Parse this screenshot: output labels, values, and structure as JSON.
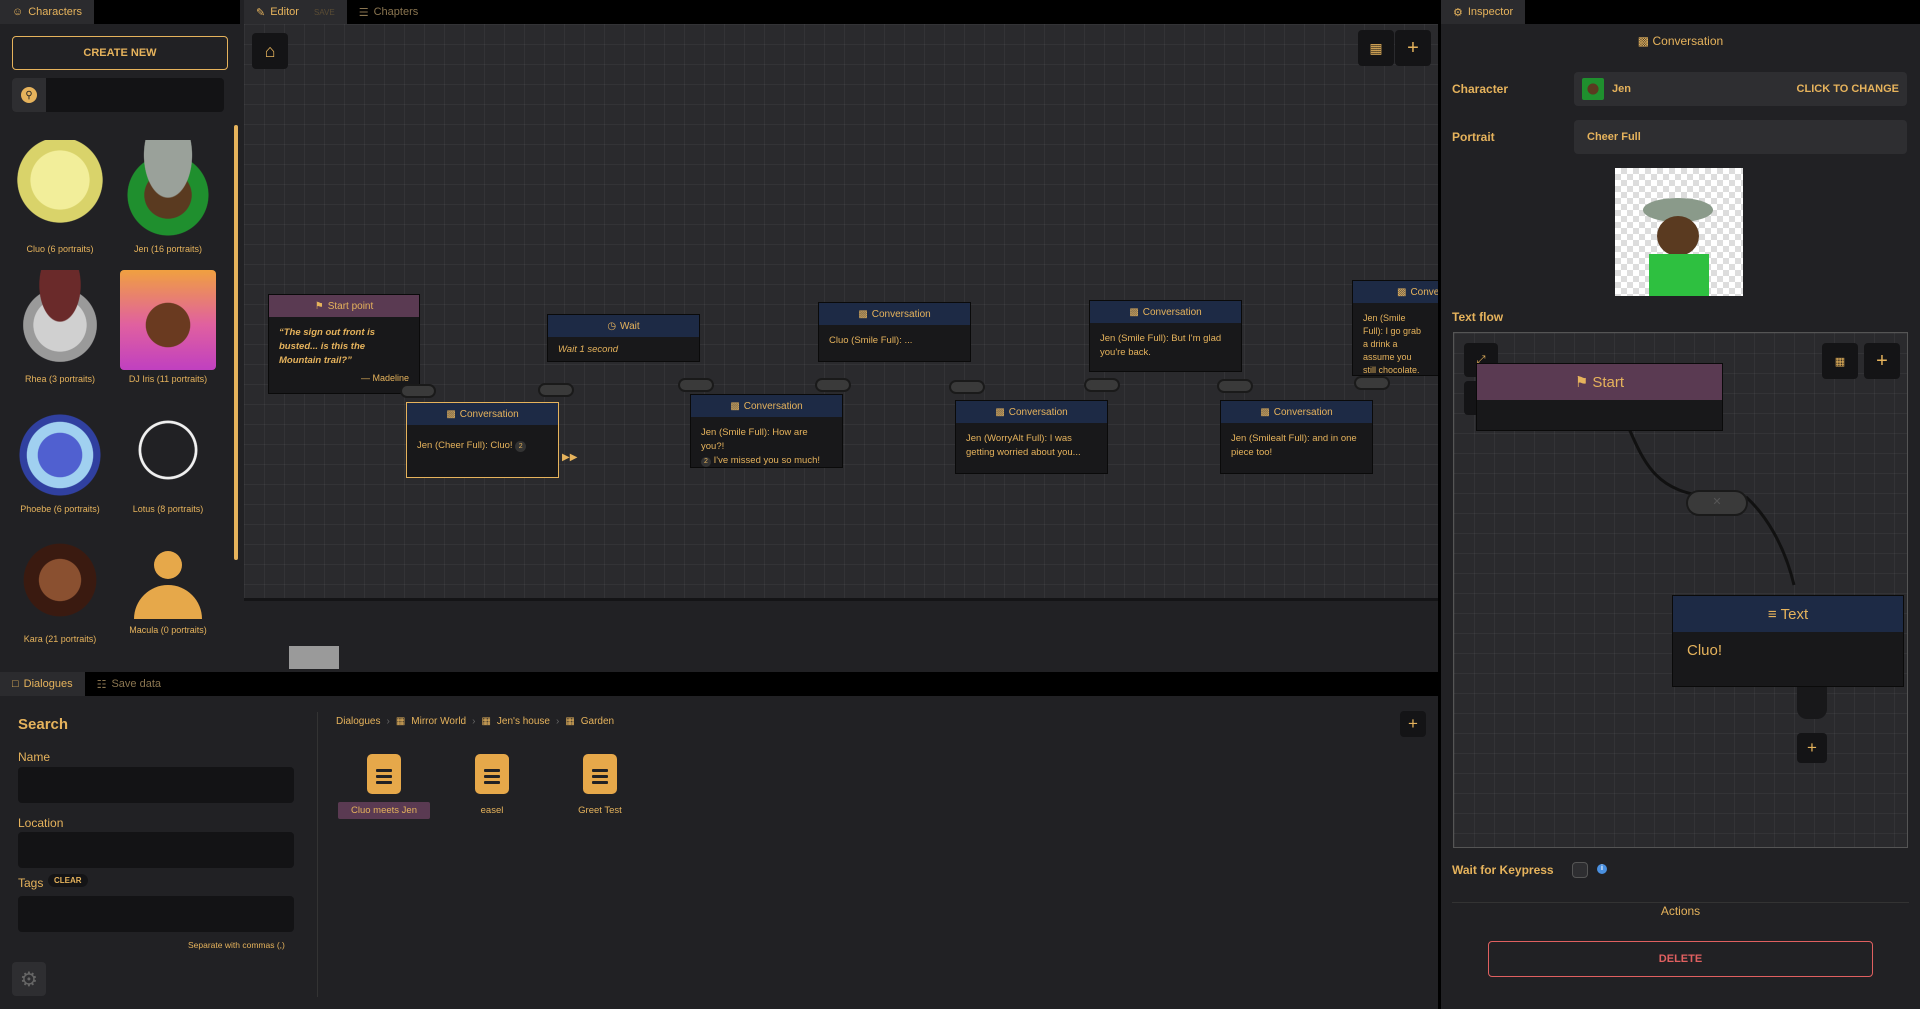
{
  "colors": {
    "accent": "#e6b35c",
    "node_header": "#1d2a45",
    "start_header": "#5a3a52",
    "delete": "#e06060"
  },
  "characters_panel": {
    "tab_label": "Characters",
    "create_button": "CREATE NEW",
    "search_placeholder": "",
    "characters": [
      {
        "name": "Cluo (6 portraits)"
      },
      {
        "name": "Jen (16 portraits)"
      },
      {
        "name": "Rhea (3 portraits)"
      },
      {
        "name": "DJ Iris (11 portraits)"
      },
      {
        "name": "Phoebe (6 portraits)"
      },
      {
        "name": "Lotus (8 portraits)"
      },
      {
        "name": "Kara (21 portraits)"
      },
      {
        "name": "Macula (0 portraits)"
      }
    ]
  },
  "editor": {
    "tabs": [
      {
        "label": "Editor",
        "save": "SAVE"
      },
      {
        "label": "Chapters"
      }
    ],
    "nodes": {
      "start": {
        "title": "Start point",
        "quote": "“The sign out front is busted... is this the Mountain trail?”",
        "author": "— Madeline"
      },
      "conv1": {
        "title": "Conversation",
        "text": "Jen (Cheer Full): Cluo!",
        "badge": "2"
      },
      "wait": {
        "title": "Wait",
        "text": "Wait 1 second"
      },
      "conv2": {
        "title": "Conversation",
        "text": "Jen (Smile Full): How are you?!",
        "text2": "I've missed you so much!",
        "badge": "2"
      },
      "conv3": {
        "title": "Conversation",
        "text": "Cluo (Smile Full): ..."
      },
      "conv4": {
        "title": "Conversation",
        "text": "Jen (WorryAlt Full): I was getting worried about you..."
      },
      "conv5": {
        "title": "Conversation",
        "text": "Jen (Smile Full): But I'm glad you're back."
      },
      "conv6": {
        "title": "Conversation",
        "text": "Jen (Smilealt Full): and in one piece too!"
      },
      "conv7": {
        "title": "Conve",
        "text": "Jen (Smile Full): I go grab a drink a assume you still chocolate."
      }
    }
  },
  "dialogues_panel": {
    "tabs": [
      {
        "label": "Dialogues"
      },
      {
        "label": "Save data"
      }
    ],
    "search_title": "Search",
    "name_label": "Name",
    "location_label": "Location",
    "tags_label": "Tags",
    "clear_label": "CLEAR",
    "hint": "Separate with commas (,)",
    "breadcrumb": [
      "Dialogues",
      "Mirror World",
      "Jen's house",
      "Garden"
    ],
    "files": [
      {
        "name": "Cluo meets Jen"
      },
      {
        "name": "easel"
      },
      {
        "name": "Greet Test"
      }
    ]
  },
  "inspector": {
    "tab_label": "Inspector",
    "section_title": "Conversation",
    "character_label": "Character",
    "character_value": "Jen",
    "change_label": "CLICK TO CHANGE",
    "portrait_label": "Portrait",
    "portrait_value": "Cheer Full",
    "text_flow_label": "Text flow",
    "flow_start": "Start",
    "flow_text_title": "Text",
    "flow_text_body": "Cluo!",
    "wait_label": "Wait for Keypress",
    "actions_label": "Actions",
    "delete_label": "DELETE"
  }
}
